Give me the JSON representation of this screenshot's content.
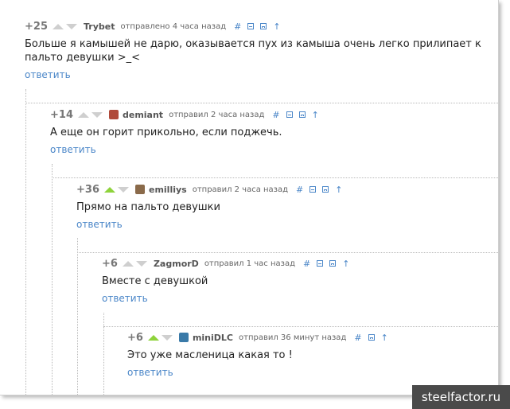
{
  "comments": [
    {
      "score": "+25",
      "upvoted": false,
      "user": "Trybet",
      "meta": "отправлено 4 часа назад",
      "hash": "#",
      "text": "Больше я камышей не дарю, оказывается пух из камыша очень легко прилипает к пальто девушки >_<",
      "reply": "ответить"
    },
    {
      "score": "+14",
      "upvoted": false,
      "user": "demiant",
      "meta": "отправил 2 часа назад",
      "hash": "#",
      "text": "А еще он горит прикольно, если поджечь.",
      "reply": "ответить"
    },
    {
      "score": "+36",
      "upvoted": true,
      "user": "emilliys",
      "meta": "отправил 2 часа назад",
      "hash": "#",
      "text": "Прямо на пальто девушки",
      "reply": "ответить"
    },
    {
      "score": "+6",
      "upvoted": false,
      "user": "ZagmorD",
      "meta": "отправил 1 час назад",
      "hash": "#",
      "text": "Вместе с девушкой",
      "reply": "ответить"
    },
    {
      "score": "+6",
      "upvoted": true,
      "user": "miniDLC",
      "meta": "отправил 36 минут назад",
      "hash": "#",
      "text": "Это уже масленица какая то !",
      "reply": "ответить"
    }
  ],
  "icons": {
    "upvote": "arrow-up-icon",
    "downvote": "arrow-down-icon",
    "collapse": "collapse-icon",
    "save": "save-icon",
    "parent": "arrow-to-parent-icon"
  },
  "colors": {
    "link": "#4a86c8",
    "upvote_active": "#8ed33b",
    "arrow_inactive": "#cfcfcf"
  },
  "watermark": "steelfactor.ru"
}
